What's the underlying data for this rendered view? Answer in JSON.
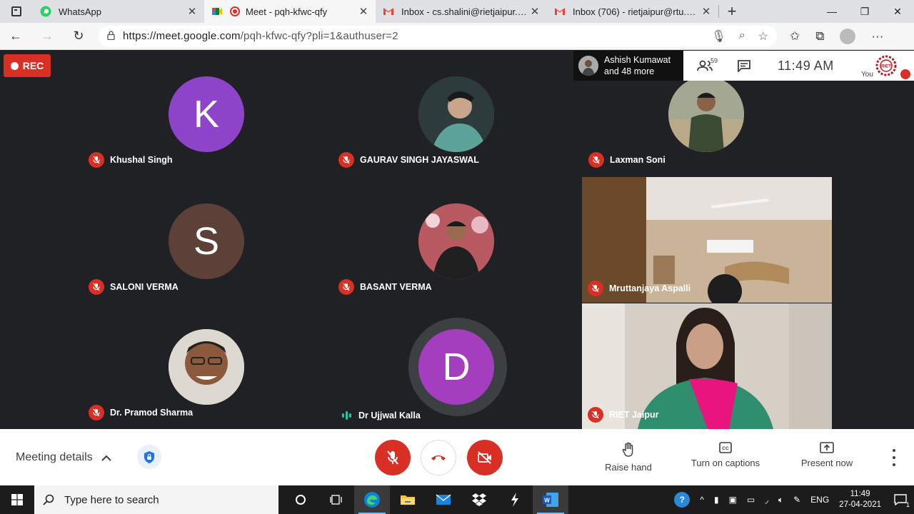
{
  "browser": {
    "tabs": [
      {
        "title": "WhatsApp",
        "favicon": "whatsapp-icon",
        "active": false
      },
      {
        "title": "Meet - pqh-kfwc-qfy",
        "favicon": "google-meet-icon",
        "active": true
      },
      {
        "title": "Inbox - cs.shalini@rietjaipur.ac.in",
        "favicon": "gmail-icon",
        "active": false
      },
      {
        "title": "Inbox (706) - rietjaipur@rtu.ac.in",
        "favicon": "gmail-icon",
        "active": false
      }
    ],
    "url_host": "https://meet.google.com",
    "url_path": "/pqh-kfwc-qfy?pli=1&authuser=2"
  },
  "meet": {
    "rec_label": "REC",
    "presence": {
      "name": "Ashish Kumawat",
      "more": "and 48 more"
    },
    "people_count": "59",
    "time": "11:49  AM",
    "you_label": "You",
    "participants": [
      {
        "name": "Khushal Singh",
        "initial": "K",
        "color": "#8e44c9",
        "muted": true
      },
      {
        "name": "GAURAV SINGH JAYASWAL",
        "initial": "",
        "color": "#3d4b4f",
        "muted": true
      },
      {
        "name": "Laxman Soni",
        "initial": "",
        "color": "#7d8a6a",
        "muted": true
      },
      {
        "name": "SALONI VERMA",
        "initial": "S",
        "color": "#5d4037",
        "muted": true
      },
      {
        "name": "BASANT VERMA",
        "initial": "",
        "color": "#a54b52",
        "muted": true
      },
      {
        "name": "Mruttanjaya Aspalli",
        "initial": "",
        "color": "#8a6f4d",
        "muted": true
      },
      {
        "name": "Dr. Pramod Sharma",
        "initial": "",
        "color": "#c9c2b8",
        "muted": true
      },
      {
        "name": "Dr Ujjwal Kalla",
        "initial": "D",
        "color": "#a33fbf",
        "muted": false
      },
      {
        "name": "RIET Jaipur",
        "initial": "",
        "color": "#cbbfb3",
        "muted": true
      }
    ]
  },
  "controls": {
    "meeting_details": "Meeting details",
    "raise_hand": "Raise hand",
    "captions": "Turn on captions",
    "present": "Present now"
  },
  "taskbar": {
    "search_placeholder": "Type here to search",
    "lang": "ENG",
    "time": "11:49",
    "date": "27-04-2021",
    "notifications": "1"
  }
}
